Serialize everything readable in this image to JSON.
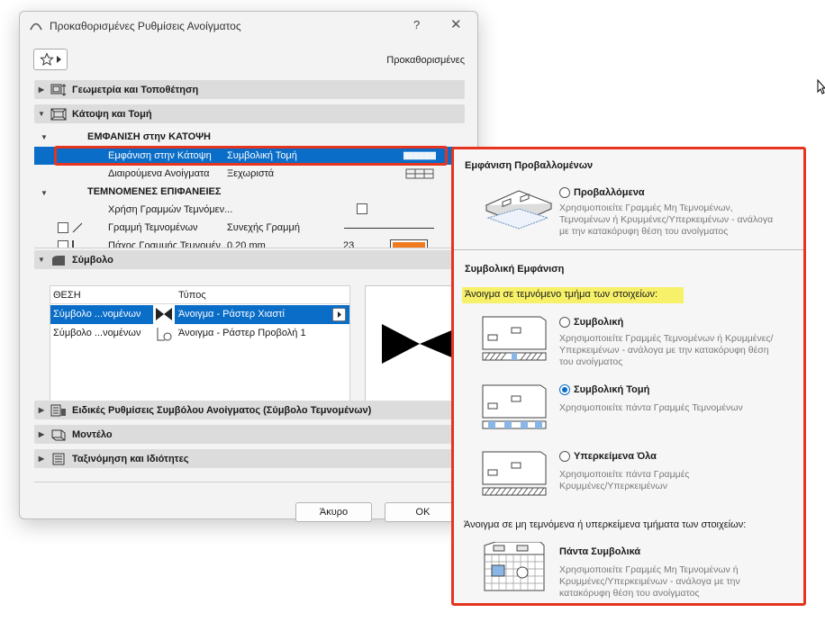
{
  "dialog": {
    "title": "Προκαθορισμένες Ρυθμίσεις Ανοίγματος",
    "help": "?",
    "close": "✕",
    "preset_label": "Προκαθορισμένες",
    "panels": {
      "geometry": "Γεωμετρία και Τοποθέτηση",
      "plan": "Κάτοψη και Τομή",
      "symbol": "Σύμβολο",
      "special": "Ειδικές Ρυθμίσεις Συμβόλου Ανοίγματος (Σύμβολο Τεμνομένων)",
      "model": "Μοντέλο",
      "classification": "Ταξινόμηση και Ιδιότητες"
    },
    "plan_section": {
      "group1": "ΕΜΦΑΝΙΣΗ στην ΚΑΤΟΨΗ",
      "rows": [
        {
          "name": "Εμφάνιση στην Κάτοψη",
          "value": "Συμβολική Τομή"
        },
        {
          "name": "Διαιρούμενα Ανοίγματα",
          "value": "Ξεχωριστά"
        }
      ],
      "group2": "ΤΕΜΝΟΜΕΝΕΣ ΕΠΙΦΑΝΕΙΕΣ",
      "rows2": [
        {
          "name": "Χρήση Γραμμών Τεμνόμεν...",
          "value": ""
        },
        {
          "name": "Γραμμή Τεμνομένων",
          "value": "Συνεχής Γραμμή"
        },
        {
          "name": "Πάχος Γραμμής Τεμνομέν...",
          "value": "0.20 mm",
          "extra": "23"
        }
      ]
    },
    "symbol_table": {
      "col1": "ΘΕΣΗ",
      "col2": "Τύπος",
      "rows": [
        {
          "pos": "Σύμβολο ...νομένων",
          "type": "Άνοιγμα - Ράστερ Χιαστί"
        },
        {
          "pos": "Σύμβολο ...νομένων",
          "type": "Άνοιγμα - Ράστερ Προβολή 1"
        }
      ]
    },
    "cancel": "Άκυρο",
    "ok": "OK"
  },
  "popup": {
    "projected_header": "Εμφάνιση Προβαλλομένων",
    "projected_title": "Προβαλλόμενα",
    "projected_desc": "Χρησιμοποιείτε Γραμμές Μη Τεμνομένων, Τεμνομένων ή Κρυμμένες/Υπερκειμένων - ανάλογα με την κατακόρυφη θέση του ανοίγματος",
    "symbolic_header": "Συμβολική Εμφάνιση",
    "highlight": "Άνοιγμα σε τεμνόμενο τμήμα των στοιχείων:",
    "opt_symbolic_title": "Συμβολική",
    "opt_symbolic_desc": "Χρησιμοποιείτε Γραμμές Τεμνομένων ή Κρυμμένες/Υπερκειμένων - ανάλογα με την κατακόρυφη θέση του ανοίγματος",
    "opt_cut_title": "Συμβολική Τομή",
    "opt_cut_desc": "Χρησιμοποιείτε πάντα Γραμμές Τεμνομένων",
    "opt_overhead_title": "Υπερκείμενα Όλα",
    "opt_overhead_desc": "Χρησιμοποιείτε πάντα Γραμμές Κρυμμένες/Υπερκειμένων",
    "noncut_header": "Άνοιγμα σε μη τεμνόμενα ή υπερκείμενα τμήματα των στοιχείων:",
    "always_title": "Πάντα Συμβολικά",
    "always_desc": "Χρησιμοποιείτε Γραμμές Μη Τεμνομένων ή Κρυμμένες/Υπερκειμένων - ανάλογα με την κατακόρυφη θέση του ανοίγματος"
  },
  "colors": {
    "accent": "#0a6dc8",
    "highlight_outline": "#e5341f",
    "highlight_fill": "#f7f16a"
  }
}
